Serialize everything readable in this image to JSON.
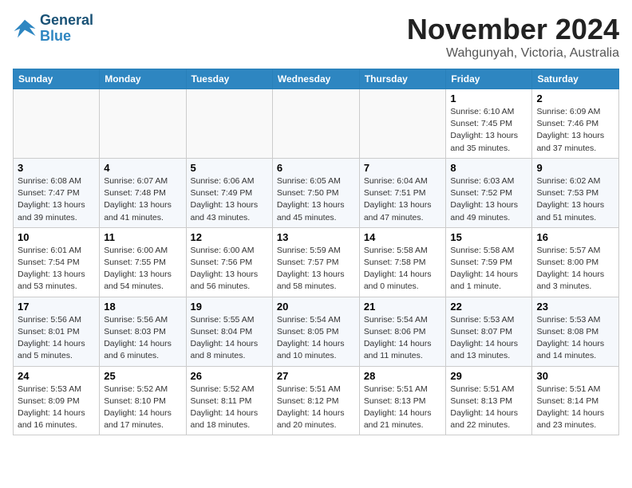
{
  "header": {
    "logo_line1": "General",
    "logo_line2": "Blue",
    "month": "November 2024",
    "location": "Wahgunyah, Victoria, Australia"
  },
  "days_of_week": [
    "Sunday",
    "Monday",
    "Tuesday",
    "Wednesday",
    "Thursday",
    "Friday",
    "Saturday"
  ],
  "weeks": [
    [
      {
        "day": "",
        "info": ""
      },
      {
        "day": "",
        "info": ""
      },
      {
        "day": "",
        "info": ""
      },
      {
        "day": "",
        "info": ""
      },
      {
        "day": "",
        "info": ""
      },
      {
        "day": "1",
        "info": "Sunrise: 6:10 AM\nSunset: 7:45 PM\nDaylight: 13 hours\nand 35 minutes."
      },
      {
        "day": "2",
        "info": "Sunrise: 6:09 AM\nSunset: 7:46 PM\nDaylight: 13 hours\nand 37 minutes."
      }
    ],
    [
      {
        "day": "3",
        "info": "Sunrise: 6:08 AM\nSunset: 7:47 PM\nDaylight: 13 hours\nand 39 minutes."
      },
      {
        "day": "4",
        "info": "Sunrise: 6:07 AM\nSunset: 7:48 PM\nDaylight: 13 hours\nand 41 minutes."
      },
      {
        "day": "5",
        "info": "Sunrise: 6:06 AM\nSunset: 7:49 PM\nDaylight: 13 hours\nand 43 minutes."
      },
      {
        "day": "6",
        "info": "Sunrise: 6:05 AM\nSunset: 7:50 PM\nDaylight: 13 hours\nand 45 minutes."
      },
      {
        "day": "7",
        "info": "Sunrise: 6:04 AM\nSunset: 7:51 PM\nDaylight: 13 hours\nand 47 minutes."
      },
      {
        "day": "8",
        "info": "Sunrise: 6:03 AM\nSunset: 7:52 PM\nDaylight: 13 hours\nand 49 minutes."
      },
      {
        "day": "9",
        "info": "Sunrise: 6:02 AM\nSunset: 7:53 PM\nDaylight: 13 hours\nand 51 minutes."
      }
    ],
    [
      {
        "day": "10",
        "info": "Sunrise: 6:01 AM\nSunset: 7:54 PM\nDaylight: 13 hours\nand 53 minutes."
      },
      {
        "day": "11",
        "info": "Sunrise: 6:00 AM\nSunset: 7:55 PM\nDaylight: 13 hours\nand 54 minutes."
      },
      {
        "day": "12",
        "info": "Sunrise: 6:00 AM\nSunset: 7:56 PM\nDaylight: 13 hours\nand 56 minutes."
      },
      {
        "day": "13",
        "info": "Sunrise: 5:59 AM\nSunset: 7:57 PM\nDaylight: 13 hours\nand 58 minutes."
      },
      {
        "day": "14",
        "info": "Sunrise: 5:58 AM\nSunset: 7:58 PM\nDaylight: 14 hours\nand 0 minutes."
      },
      {
        "day": "15",
        "info": "Sunrise: 5:58 AM\nSunset: 7:59 PM\nDaylight: 14 hours\nand 1 minute."
      },
      {
        "day": "16",
        "info": "Sunrise: 5:57 AM\nSunset: 8:00 PM\nDaylight: 14 hours\nand 3 minutes."
      }
    ],
    [
      {
        "day": "17",
        "info": "Sunrise: 5:56 AM\nSunset: 8:01 PM\nDaylight: 14 hours\nand 5 minutes."
      },
      {
        "day": "18",
        "info": "Sunrise: 5:56 AM\nSunset: 8:03 PM\nDaylight: 14 hours\nand 6 minutes."
      },
      {
        "day": "19",
        "info": "Sunrise: 5:55 AM\nSunset: 8:04 PM\nDaylight: 14 hours\nand 8 minutes."
      },
      {
        "day": "20",
        "info": "Sunrise: 5:54 AM\nSunset: 8:05 PM\nDaylight: 14 hours\nand 10 minutes."
      },
      {
        "day": "21",
        "info": "Sunrise: 5:54 AM\nSunset: 8:06 PM\nDaylight: 14 hours\nand 11 minutes."
      },
      {
        "day": "22",
        "info": "Sunrise: 5:53 AM\nSunset: 8:07 PM\nDaylight: 14 hours\nand 13 minutes."
      },
      {
        "day": "23",
        "info": "Sunrise: 5:53 AM\nSunset: 8:08 PM\nDaylight: 14 hours\nand 14 minutes."
      }
    ],
    [
      {
        "day": "24",
        "info": "Sunrise: 5:53 AM\nSunset: 8:09 PM\nDaylight: 14 hours\nand 16 minutes."
      },
      {
        "day": "25",
        "info": "Sunrise: 5:52 AM\nSunset: 8:10 PM\nDaylight: 14 hours\nand 17 minutes."
      },
      {
        "day": "26",
        "info": "Sunrise: 5:52 AM\nSunset: 8:11 PM\nDaylight: 14 hours\nand 18 minutes."
      },
      {
        "day": "27",
        "info": "Sunrise: 5:51 AM\nSunset: 8:12 PM\nDaylight: 14 hours\nand 20 minutes."
      },
      {
        "day": "28",
        "info": "Sunrise: 5:51 AM\nSunset: 8:13 PM\nDaylight: 14 hours\nand 21 minutes."
      },
      {
        "day": "29",
        "info": "Sunrise: 5:51 AM\nSunset: 8:13 PM\nDaylight: 14 hours\nand 22 minutes."
      },
      {
        "day": "30",
        "info": "Sunrise: 5:51 AM\nSunset: 8:14 PM\nDaylight: 14 hours\nand 23 minutes."
      }
    ]
  ]
}
